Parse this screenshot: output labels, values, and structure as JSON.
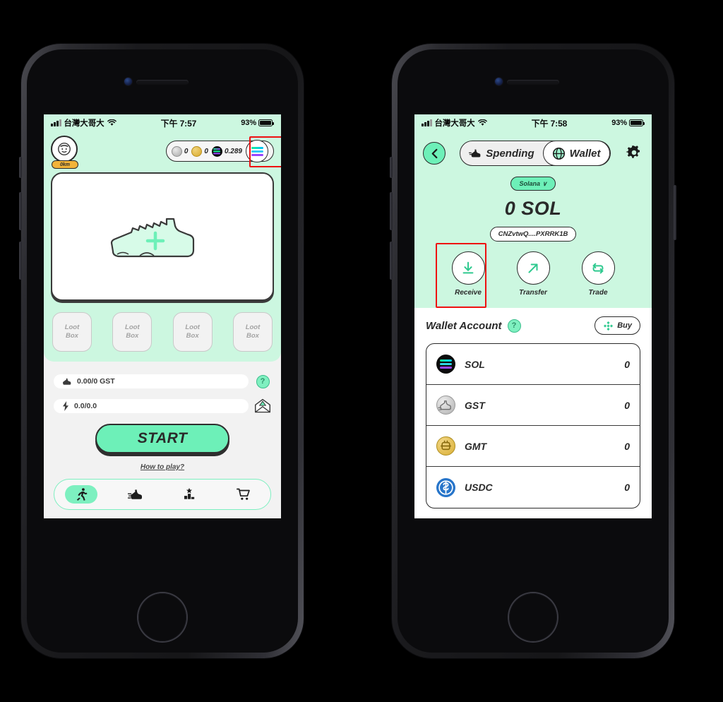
{
  "left_phone": {
    "statusbar": {
      "carrier": "台灣大哥大",
      "time": "下午 7:57",
      "battery": "93%"
    },
    "header": {
      "avatar_icon": "user-avatar-icon",
      "distance_badge": "0km",
      "tokens": [
        {
          "icon": "gst-coin-icon",
          "value": "0"
        },
        {
          "icon": "gmt-coin-icon",
          "value": "0"
        },
        {
          "icon": "sol-coin-icon",
          "value": "0.289"
        }
      ],
      "wallet_button_icon": "solana-wallet-icon",
      "wallet_button_highlighted": true
    },
    "shoe_card": {
      "icon": "sneaker-outline-icon",
      "add_icon": "plus-icon"
    },
    "loot_boxes": [
      {
        "line1": "Loot",
        "line2": "Box"
      },
      {
        "line1": "Loot",
        "line2": "Box"
      },
      {
        "line1": "Loot",
        "line2": "Box"
      },
      {
        "line1": "Loot",
        "line2": "Box"
      }
    ],
    "stats": [
      {
        "icon": "sneaker-icon",
        "value": "0.00/0 GST"
      },
      {
        "icon": "lightning-bolt-icon",
        "value": "0.0/0.0"
      }
    ],
    "side_icons": [
      {
        "icon": "question-mark-icon",
        "label": "?"
      },
      {
        "icon": "mail-envelope-icon",
        "label": ""
      }
    ],
    "start_button": "START",
    "how_to_play": "How to play?",
    "nav": [
      {
        "icon": "running-man-icon",
        "active": true
      },
      {
        "icon": "sneaker-speed-icon",
        "active": false
      },
      {
        "icon": "podium-star-icon",
        "active": false
      },
      {
        "icon": "shopping-cart-icon",
        "active": false
      }
    ]
  },
  "right_phone": {
    "statusbar": {
      "carrier": "台灣大哥大",
      "time": "下午 7:58",
      "battery": "93%"
    },
    "header": {
      "back_icon": "chevron-left-icon",
      "tabs": [
        {
          "label": "Spending",
          "icon": "sneaker-speed-icon",
          "active": false
        },
        {
          "label": "Wallet",
          "icon": "globe-icon",
          "active": true
        }
      ],
      "settings_icon": "gear-icon"
    },
    "chain_selector": {
      "label": "Solana",
      "chevron": "∨"
    },
    "balance": "0 SOL",
    "address": "CNZvtwQ....PXRRK1B",
    "actions": [
      {
        "label": "Receive",
        "icon": "download-arrow-icon",
        "highlighted": true
      },
      {
        "label": "Transfer",
        "icon": "arrow-up-right-icon",
        "highlighted": false
      },
      {
        "label": "Trade",
        "icon": "swap-repeat-icon",
        "highlighted": false
      }
    ],
    "wallet_account": {
      "title": "Wallet Account",
      "help_icon": "question-mark-icon",
      "buy_button": {
        "label": "Buy",
        "icon": "binance-diamond-icon"
      },
      "tokens": [
        {
          "icon": "sol-token-icon",
          "name": "SOL",
          "amount": "0"
        },
        {
          "icon": "gst-token-icon",
          "name": "GST",
          "amount": "0"
        },
        {
          "icon": "gmt-token-icon",
          "name": "GMT",
          "amount": "0"
        },
        {
          "icon": "usdc-token-icon",
          "name": "USDC",
          "amount": "0"
        }
      ]
    }
  },
  "colors": {
    "mint_bg": "#ccf7e0",
    "accent_green": "#6df0b8",
    "highlight_red": "#ee1111",
    "ink": "#2a2a2a"
  }
}
